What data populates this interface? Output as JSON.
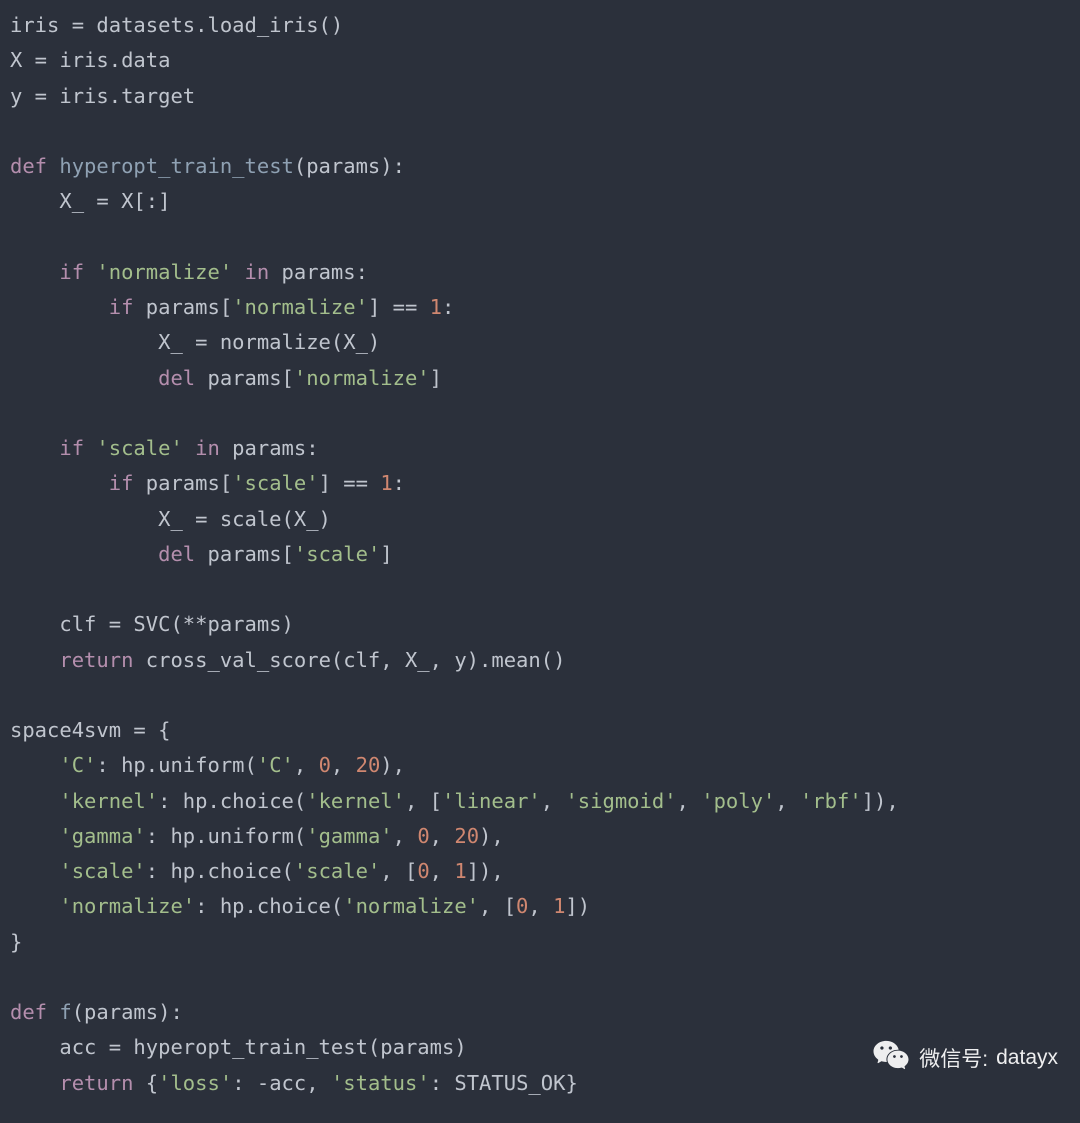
{
  "code": {
    "lines": [
      [
        [
          "var",
          "iris = datasets.load_iris()"
        ]
      ],
      [
        [
          "var",
          "X = iris.data"
        ]
      ],
      [
        [
          "var",
          "y = iris.target"
        ]
      ],
      [
        [
          "var",
          ""
        ]
      ],
      [
        [
          "kw",
          "def"
        ],
        [
          "var",
          " "
        ],
        [
          "fn",
          "hyperopt_train_test"
        ],
        [
          "var",
          "(params):"
        ]
      ],
      [
        [
          "var",
          "    X_ = X[:]"
        ]
      ],
      [
        [
          "var",
          ""
        ]
      ],
      [
        [
          "var",
          "    "
        ],
        [
          "kw",
          "if"
        ],
        [
          "var",
          " "
        ],
        [
          "str",
          "'normalize'"
        ],
        [
          "var",
          " "
        ],
        [
          "kw",
          "in"
        ],
        [
          "var",
          " params:"
        ]
      ],
      [
        [
          "var",
          "        "
        ],
        [
          "kw",
          "if"
        ],
        [
          "var",
          " params["
        ],
        [
          "str",
          "'normalize'"
        ],
        [
          "var",
          "] == "
        ],
        [
          "num",
          "1"
        ],
        [
          "var",
          ":"
        ]
      ],
      [
        [
          "var",
          "            X_ = normalize(X_)"
        ]
      ],
      [
        [
          "var",
          "            "
        ],
        [
          "kw",
          "del"
        ],
        [
          "var",
          " params["
        ],
        [
          "str",
          "'normalize'"
        ],
        [
          "var",
          "]"
        ]
      ],
      [
        [
          "var",
          ""
        ]
      ],
      [
        [
          "var",
          "    "
        ],
        [
          "kw",
          "if"
        ],
        [
          "var",
          " "
        ],
        [
          "str",
          "'scale'"
        ],
        [
          "var",
          " "
        ],
        [
          "kw",
          "in"
        ],
        [
          "var",
          " params:"
        ]
      ],
      [
        [
          "var",
          "        "
        ],
        [
          "kw",
          "if"
        ],
        [
          "var",
          " params["
        ],
        [
          "str",
          "'scale'"
        ],
        [
          "var",
          "] == "
        ],
        [
          "num",
          "1"
        ],
        [
          "var",
          ":"
        ]
      ],
      [
        [
          "var",
          "            X_ = scale(X_)"
        ]
      ],
      [
        [
          "var",
          "            "
        ],
        [
          "kw",
          "del"
        ],
        [
          "var",
          " params["
        ],
        [
          "str",
          "'scale'"
        ],
        [
          "var",
          "]"
        ]
      ],
      [
        [
          "var",
          ""
        ]
      ],
      [
        [
          "var",
          "    clf = SVC(**params)"
        ]
      ],
      [
        [
          "var",
          "    "
        ],
        [
          "kw",
          "return"
        ],
        [
          "var",
          " cross_val_score(clf, X_, y).mean()"
        ]
      ],
      [
        [
          "var",
          ""
        ]
      ],
      [
        [
          "var",
          "space4svm = {"
        ]
      ],
      [
        [
          "var",
          "    "
        ],
        [
          "str",
          "'C'"
        ],
        [
          "var",
          ": hp.uniform("
        ],
        [
          "str",
          "'C'"
        ],
        [
          "var",
          ", "
        ],
        [
          "num",
          "0"
        ],
        [
          "var",
          ", "
        ],
        [
          "num",
          "20"
        ],
        [
          "var",
          "),"
        ]
      ],
      [
        [
          "var",
          "    "
        ],
        [
          "str",
          "'kernel'"
        ],
        [
          "var",
          ": hp.choice("
        ],
        [
          "str",
          "'kernel'"
        ],
        [
          "var",
          ", ["
        ],
        [
          "str",
          "'linear'"
        ],
        [
          "var",
          ", "
        ],
        [
          "str",
          "'sigmoid'"
        ],
        [
          "var",
          ", "
        ],
        [
          "str",
          "'poly'"
        ],
        [
          "var",
          ", "
        ],
        [
          "str",
          "'rbf'"
        ],
        [
          "var",
          "]),"
        ]
      ],
      [
        [
          "var",
          "    "
        ],
        [
          "str",
          "'gamma'"
        ],
        [
          "var",
          ": hp.uniform("
        ],
        [
          "str",
          "'gamma'"
        ],
        [
          "var",
          ", "
        ],
        [
          "num",
          "0"
        ],
        [
          "var",
          ", "
        ],
        [
          "num",
          "20"
        ],
        [
          "var",
          "),"
        ]
      ],
      [
        [
          "var",
          "    "
        ],
        [
          "str",
          "'scale'"
        ],
        [
          "var",
          ": hp.choice("
        ],
        [
          "str",
          "'scale'"
        ],
        [
          "var",
          ", ["
        ],
        [
          "num",
          "0"
        ],
        [
          "var",
          ", "
        ],
        [
          "num",
          "1"
        ],
        [
          "var",
          "]),"
        ]
      ],
      [
        [
          "var",
          "    "
        ],
        [
          "str",
          "'normalize'"
        ],
        [
          "var",
          ": hp.choice("
        ],
        [
          "str",
          "'normalize'"
        ],
        [
          "var",
          ", ["
        ],
        [
          "num",
          "0"
        ],
        [
          "var",
          ", "
        ],
        [
          "num",
          "1"
        ],
        [
          "var",
          "])"
        ]
      ],
      [
        [
          "var",
          "}"
        ]
      ],
      [
        [
          "var",
          ""
        ]
      ],
      [
        [
          "kw",
          "def"
        ],
        [
          "var",
          " "
        ],
        [
          "fn",
          "f"
        ],
        [
          "var",
          "(params):"
        ]
      ],
      [
        [
          "var",
          "    acc = hyperopt_train_test(params)"
        ]
      ],
      [
        [
          "var",
          "    "
        ],
        [
          "kw",
          "return"
        ],
        [
          "var",
          " {"
        ],
        [
          "str",
          "'loss'"
        ],
        [
          "var",
          ": -acc, "
        ],
        [
          "str",
          "'status'"
        ],
        [
          "var",
          ": STATUS_OK}"
        ]
      ]
    ]
  },
  "watermark": {
    "label": "微信号:",
    "handle": "datayx"
  }
}
